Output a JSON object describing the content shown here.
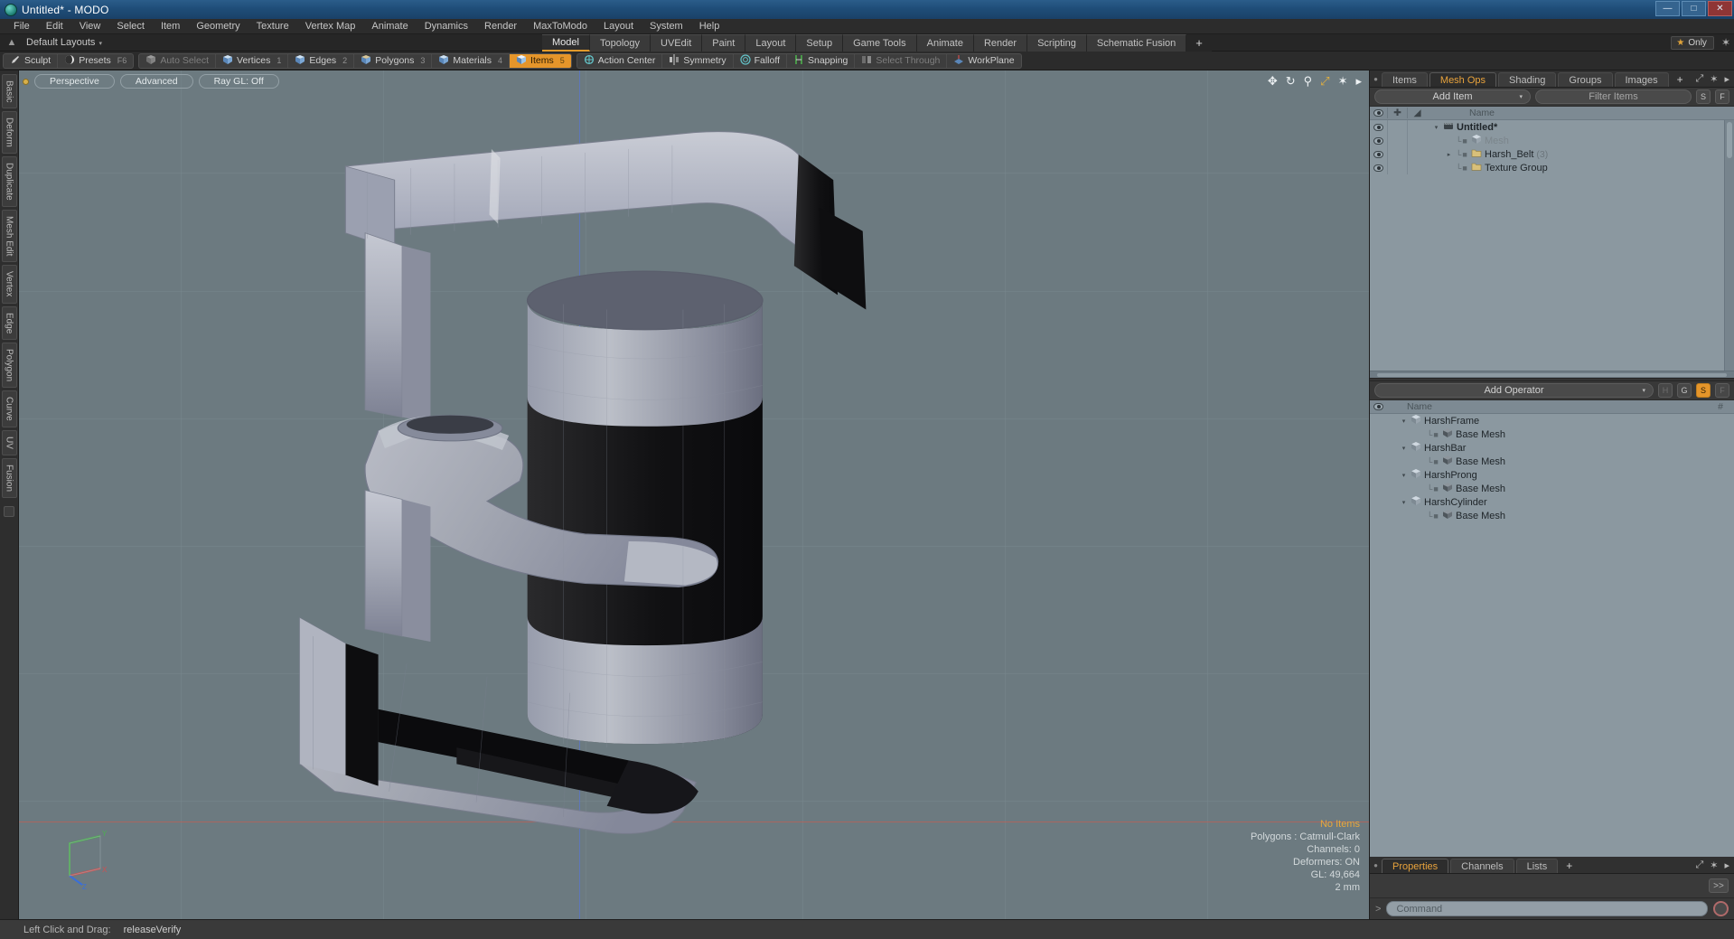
{
  "titlebar": {
    "title": "Untitled* - MODO",
    "app_icon": "modo-logo-icon",
    "minimize": "—",
    "maximize": "□",
    "close": "✕"
  },
  "menubar": {
    "items": [
      "File",
      "Edit",
      "View",
      "Select",
      "Item",
      "Geometry",
      "Texture",
      "Vertex Map",
      "Animate",
      "Dynamics",
      "Render",
      "MaxToModo",
      "Layout",
      "System",
      "Help"
    ]
  },
  "layoutrow": {
    "home_icon": "home-icon",
    "default_layouts": "Default Layouts",
    "caret": "▾",
    "tabs": [
      {
        "label": "Model",
        "active": true
      },
      {
        "label": "Topology",
        "active": false
      },
      {
        "label": "UVEdit",
        "active": false
      },
      {
        "label": "Paint",
        "active": false
      },
      {
        "label": "Layout",
        "active": false
      },
      {
        "label": "Setup",
        "active": false
      },
      {
        "label": "Game Tools",
        "active": false
      },
      {
        "label": "Animate",
        "active": false
      },
      {
        "label": "Render",
        "active": false
      },
      {
        "label": "Scripting",
        "active": false
      },
      {
        "label": "Schematic Fusion",
        "active": false
      }
    ],
    "add_tab": "+",
    "only_label": "Only",
    "star_icon": "star-icon",
    "gear_icon": "gear-icon"
  },
  "modebar": {
    "groups": [
      {
        "buttons": [
          {
            "label": "Sculpt",
            "icon": "sculpt-brush-icon",
            "shortcut": "",
            "state": "normal"
          },
          {
            "label": "Presets",
            "icon": "presets-sphere-icon",
            "shortcut": "F6",
            "state": "normal"
          }
        ]
      },
      {
        "buttons": [
          {
            "label": "Auto Select",
            "icon": "auto-select-cube-icon",
            "shortcut": "",
            "state": "dim"
          },
          {
            "label": "Vertices",
            "icon": "vertices-cube-icon",
            "shortcut": "1",
            "state": "normal"
          },
          {
            "label": "Edges",
            "icon": "edges-cube-icon",
            "shortcut": "2",
            "state": "normal"
          },
          {
            "label": "Polygons",
            "icon": "polygons-cube-icon",
            "shortcut": "3",
            "state": "normal"
          },
          {
            "label": "Materials",
            "icon": "materials-cube-icon",
            "shortcut": "4",
            "state": "normal"
          },
          {
            "label": "Items",
            "icon": "items-cube-icon",
            "shortcut": "5",
            "state": "active"
          }
        ]
      },
      {
        "buttons": [
          {
            "label": "Action Center",
            "icon": "action-center-icon",
            "shortcut": "",
            "state": "normal"
          },
          {
            "label": "Symmetry",
            "icon": "symmetry-icon",
            "shortcut": "",
            "state": "normal"
          },
          {
            "label": "Falloff",
            "icon": "falloff-icon",
            "shortcut": "",
            "state": "normal"
          },
          {
            "label": "Snapping",
            "icon": "snapping-icon",
            "shortcut": "",
            "state": "normal"
          },
          {
            "label": "Select Through",
            "icon": "select-through-icon",
            "shortcut": "",
            "state": "dim"
          },
          {
            "label": "WorkPlane",
            "icon": "workplane-icon",
            "shortcut": "",
            "state": "normal"
          }
        ]
      }
    ]
  },
  "left_toolbar": {
    "tabs": [
      "Basic",
      "Deform",
      "Duplicate",
      "Mesh Edit",
      "Vertex",
      "Edge",
      "Polygon",
      "Curve",
      "UV",
      "Fusion"
    ]
  },
  "viewport": {
    "dot": "viewport-active-dot",
    "buttons": [
      {
        "label": "Perspective",
        "name": "view-mode-button"
      },
      {
        "label": "Advanced",
        "name": "shading-mode-button"
      },
      {
        "label": "Ray GL: Off",
        "name": "raygl-toggle-button"
      }
    ],
    "tools": [
      {
        "icon": "move-icon",
        "glyph": "✥",
        "gold": false
      },
      {
        "icon": "rotate-icon",
        "glyph": "↻",
        "gold": false
      },
      {
        "icon": "zoom-icon",
        "glyph": "⌕",
        "gold": false
      },
      {
        "icon": "fit-icon",
        "glyph": "⤢",
        "gold": true
      },
      {
        "icon": "gear-icon",
        "glyph": "✲",
        "gold": false
      },
      {
        "icon": "chevron-right-icon",
        "glyph": "▸",
        "gold": false
      }
    ],
    "stats": {
      "selection": "No Items",
      "polygons": "Polygons : Catmull-Clark",
      "channels": "Channels: 0",
      "deformers": "Deformers: ON",
      "gl": "GL: 49,664",
      "unit": "2 mm"
    },
    "gizmo": {
      "x": "X",
      "y": "Y",
      "z": "Z"
    },
    "background_color": "#6c7a80"
  },
  "statusbar": {
    "label": "Left Click and Drag:",
    "value": "releaseVerify"
  },
  "right_panel": {
    "top": {
      "tabs": [
        {
          "label": "Items",
          "active": false
        },
        {
          "label": "Mesh Ops",
          "active": true
        },
        {
          "label": "Shading",
          "active": false
        },
        {
          "label": "Groups",
          "active": false
        },
        {
          "label": "Images",
          "active": false
        }
      ],
      "add_tab": "+",
      "expand_icon": "expand-icon",
      "gear_icon": "gear-icon",
      "chevron_icon": "chevron-right-icon",
      "add_item": "Add Item",
      "dropdown_arrow": "▾",
      "filter_placeholder": "Filter Items",
      "btn_s": "S",
      "btn_f": "F",
      "columns": {
        "eye": "visibility-icon",
        "lock": "lock-icon",
        "render": "render-icon",
        "name": "Name"
      },
      "rows": [
        {
          "name": "Untitled*",
          "icon": "scene-icon",
          "indent": 0,
          "bold": true,
          "dim": false,
          "twist": "▾",
          "count": ""
        },
        {
          "name": "Mesh",
          "icon": "mesh-icon",
          "indent": 1,
          "bold": false,
          "dim": true,
          "twist": "",
          "count": ""
        },
        {
          "name": "Harsh_Belt",
          "icon": "folder-icon",
          "indent": 1,
          "bold": false,
          "dim": false,
          "twist": "▸",
          "count": "(3)"
        },
        {
          "name": "Texture Group",
          "icon": "folder-icon",
          "indent": 1,
          "bold": false,
          "dim": false,
          "twist": "",
          "count": ""
        }
      ]
    },
    "bottom": {
      "add_operator": "Add Operator",
      "dropdown_arrow": "▾",
      "toggles": [
        {
          "label": "H",
          "state": "off"
        },
        {
          "label": "G",
          "state": "normal"
        },
        {
          "label": "S",
          "state": "on"
        },
        {
          "label": "F",
          "state": "off"
        }
      ],
      "columns": {
        "eye": "visibility-icon",
        "name": "Name",
        "hash": "#"
      },
      "rows": [
        {
          "name": "HarshFrame",
          "icon": "mesh-icon",
          "indent": 0,
          "twist": "▾"
        },
        {
          "name": "Base Mesh",
          "icon": "base-mesh-icon",
          "indent": 1,
          "twist": ""
        },
        {
          "name": "HarshBar",
          "icon": "mesh-icon",
          "indent": 0,
          "twist": "▾"
        },
        {
          "name": "Base Mesh",
          "icon": "base-mesh-icon",
          "indent": 1,
          "twist": ""
        },
        {
          "name": "HarshProng",
          "icon": "mesh-icon",
          "indent": 0,
          "twist": "▾"
        },
        {
          "name": "Base Mesh",
          "icon": "base-mesh-icon",
          "indent": 1,
          "twist": ""
        },
        {
          "name": "HarshCylinder",
          "icon": "mesh-icon",
          "indent": 0,
          "twist": "▾"
        },
        {
          "name": "Base Mesh",
          "icon": "base-mesh-icon",
          "indent": 1,
          "twist": ""
        }
      ]
    },
    "props": {
      "tabs": [
        {
          "label": "Properties",
          "active": true
        },
        {
          "label": "Channels",
          "active": false
        },
        {
          "label": "Lists",
          "active": false
        }
      ],
      "add_tab": "+",
      "expand_icon": "expand-icon",
      "gear_icon": "gear-icon",
      "chevron_icon": "chevron-right-icon",
      "collapse_btn": ">>"
    },
    "command": {
      "prompt": ">",
      "placeholder": "Command",
      "record_icon": "record-icon"
    }
  },
  "colors": {
    "accent_orange": "#e5952a",
    "viewport_bg": "#6c7a80",
    "panel_bg": "#3a3a3a",
    "tree_bg": "#8b98a0",
    "title_blue": "#1f4d78"
  }
}
